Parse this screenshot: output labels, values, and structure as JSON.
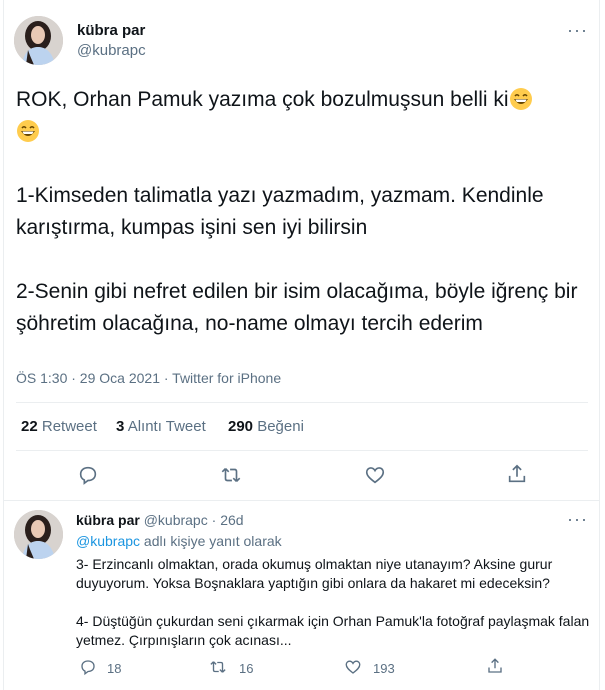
{
  "main_tweet": {
    "author_name": "kübra par",
    "author_handle": "@kubrapc",
    "text_line1": "ROK, Orhan Pamuk yazıma çok bozulmuşsun belli ki",
    "text_para2": "1-Kimseden talimatla yazı yazmadım, yazmam. Kendinle karıştırma, kumpas işini sen iyi bilirsin",
    "text_para3": "2-Senin gibi nefret edilen bir isim olacağıma, böyle iğrenç bir şöhretim olacağına, no-name olmayı tercih ederim",
    "timestamp": "ÖS 1:30 · 29 Oca 2021 · Twitter for iPhone",
    "stats": {
      "retweets_count": "22",
      "retweets_label": "Retweet",
      "quotes_count": "3",
      "quotes_label": "Alıntı Tweet",
      "likes_count": "290",
      "likes_label": "Beğeni"
    },
    "icons": [
      "reply-icon",
      "retweet-icon",
      "like-icon",
      "share-icon",
      "more-icon",
      "grinning-emoji"
    ]
  },
  "reply_tweet": {
    "author_name": "kübra par",
    "author_handle": "@kubrapc",
    "time_sep": "·",
    "time": "26d",
    "replying_to_handle": "@kubrapc",
    "replying_to_suffix": "adlı kişiye yanıt olarak",
    "text": "3- Erzincanlı olmaktan, orada okumuş olmaktan niye utanayım? Aksine gurur duyuyorum. Yoksa Boşnaklara yaptığın gibi onlara da hakaret mi edeceksin?\n\n4- Düştüğün çukurdan seni çıkarmak için Orhan Pamuk'la fotoğraf paylaşmak falan yetmez. Çırpınışların çok acınası...",
    "reply_count": "18",
    "retweet_count": "16",
    "like_count": "193"
  },
  "colors": {
    "text": "#0f1419",
    "muted": "#5b7083",
    "link": "#1b95e0",
    "divider": "#ebeef0"
  }
}
